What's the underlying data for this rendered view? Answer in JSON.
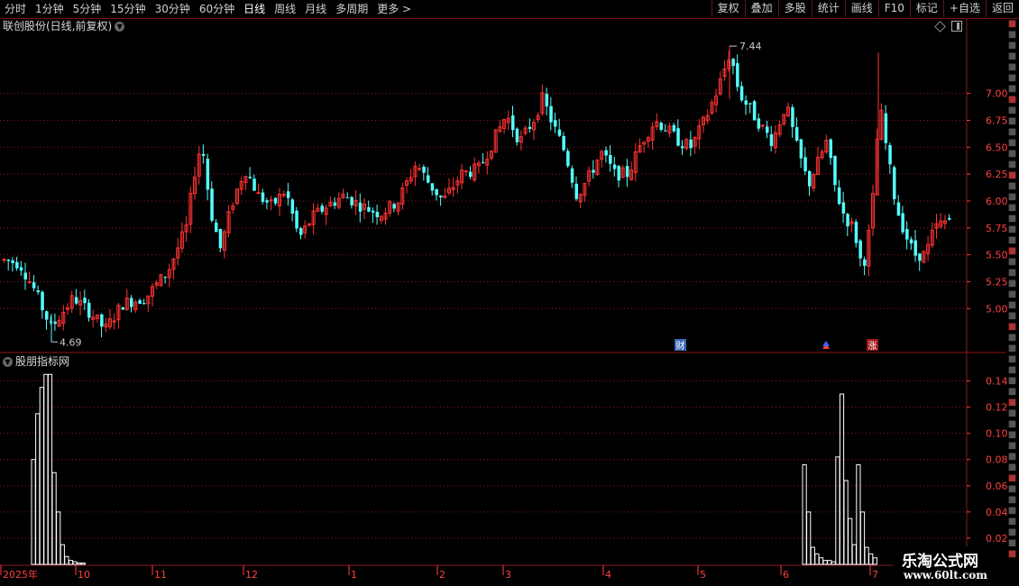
{
  "toolbar": {
    "periods": [
      "分时",
      "1分钟",
      "5分钟",
      "15分钟",
      "30分钟",
      "60分钟",
      "日线",
      "周线",
      "月线",
      "多周期",
      "更多 >"
    ],
    "active_period": "日线",
    "buttons": [
      "复权",
      "叠加",
      "多股",
      "统计",
      "画线",
      "F10",
      "标记",
      "+自选",
      "返回"
    ]
  },
  "main_panel": {
    "title": "联创股份(日线,前复权)",
    "price_axis_labels": [
      "7.00",
      "6.75",
      "6.50",
      "6.25",
      "6.00",
      "5.75",
      "5.50",
      "5.25",
      "5.00"
    ],
    "high_marker": "7.44",
    "low_marker": "4.69",
    "event_badges": [
      {
        "label": "财",
        "color": "#3a6ab8"
      },
      {
        "label": "涨",
        "color": "#a01818"
      }
    ]
  },
  "indicator_panel": {
    "title": "股朋指标网",
    "axis_labels": [
      "0.14",
      "0.12",
      "0.10",
      "0.08",
      "0.06",
      "0.04",
      "0.02"
    ]
  },
  "time_axis": [
    "2025年",
    "10",
    "11",
    "12",
    "1",
    "2",
    "3",
    "4",
    "5",
    "6",
    "7"
  ],
  "watermark": {
    "title": "乐淘公式网",
    "url": "www.60lt.com"
  },
  "colors": {
    "up": "#ff3232",
    "down": "#54ffff",
    "grid": "#8b1a1a",
    "axis_text": "#ff4040",
    "bar": "#ffffff"
  },
  "chart_data": {
    "type": "candlestick",
    "title": "联创股份(日线,前复权)",
    "price_range": [
      4.6,
      7.55
    ],
    "max_price": 7.44,
    "min_price": 4.69,
    "time_axis_ticks": [
      "2025年",
      "10",
      "11",
      "12",
      "1",
      "2",
      "3",
      "4",
      "5",
      "6",
      "7"
    ],
    "indicator": {
      "name": "股朋指标网",
      "type": "bar",
      "ylim": [
        0,
        0.15
      ],
      "clusters": [
        {
          "period": "September-October 2025",
          "values": [
            0.08,
            0.115,
            0.135,
            0.145,
            0.145,
            0.07,
            0.04,
            0.015,
            0.006,
            0.003,
            0.002,
            0.001,
            0.001
          ]
        },
        {
          "period": "June-July 2026",
          "values": [
            0.076,
            0.04,
            0.013,
            0.008,
            0.005,
            0.003,
            0.003,
            0.002,
            0.082,
            0.13,
            0.064,
            0.035,
            0.015,
            0.076,
            0.04,
            0.013,
            0.008,
            0.005
          ]
        }
      ]
    }
  }
}
